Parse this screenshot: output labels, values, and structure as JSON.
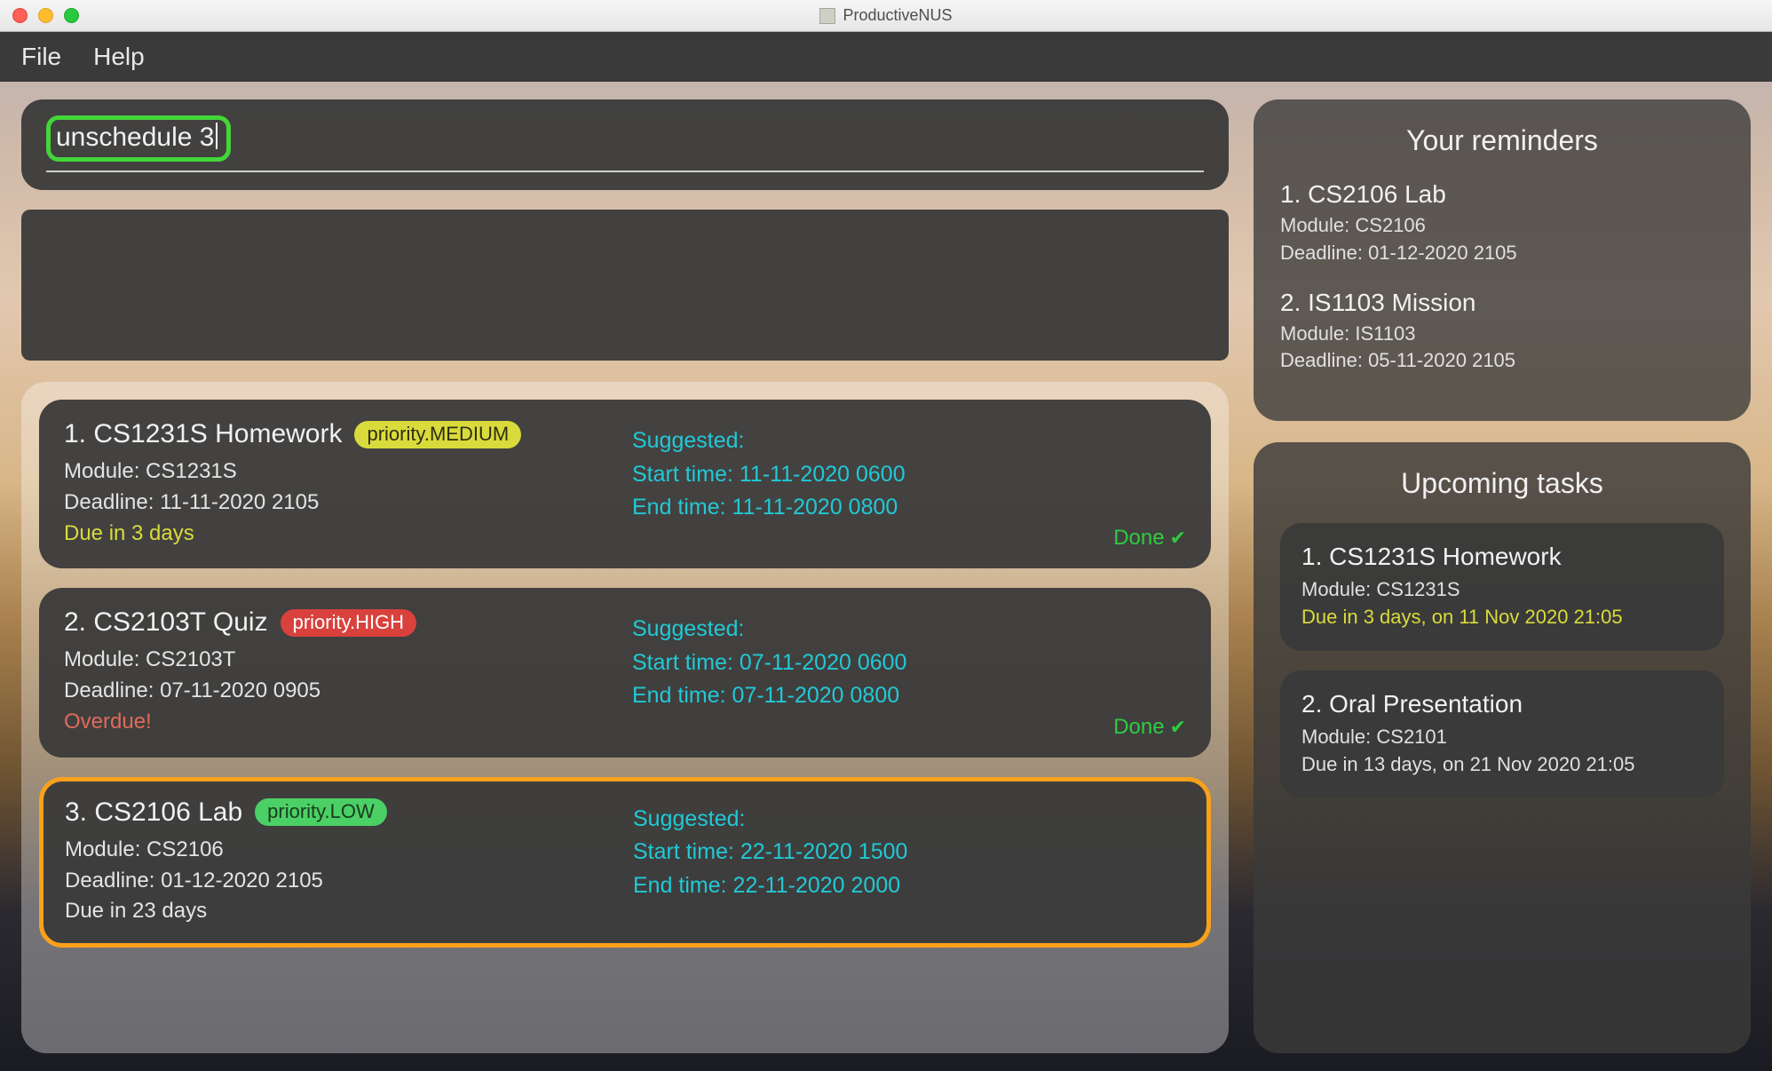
{
  "window": {
    "title": "ProductiveNUS"
  },
  "menu": {
    "file": "File",
    "help": "Help"
  },
  "command_input": {
    "value": "unschedule 3"
  },
  "tasks": [
    {
      "index": "1.",
      "title": "CS1231S Homework",
      "priority_label": "priority.MEDIUM",
      "priority_level": "medium",
      "module": "Module: CS1231S",
      "deadline": "Deadline: 11-11-2020 2105",
      "due_text": "Due in 3 days",
      "due_class": "due-soft",
      "suggested_header": "Suggested:",
      "suggested_start": "Start time: 11-11-2020 0600",
      "suggested_end": "End time: 11-11-2020 0800",
      "done": "Done",
      "selected": false
    },
    {
      "index": "2.",
      "title": "CS2103T Quiz",
      "priority_label": "priority.HIGH",
      "priority_level": "high",
      "module": "Module: CS2103T",
      "deadline": "Deadline: 07-11-2020 0905",
      "due_text": "Overdue!",
      "due_class": "overdue",
      "suggested_header": "Suggested:",
      "suggested_start": "Start time: 07-11-2020 0600",
      "suggested_end": "End time: 07-11-2020 0800",
      "done": "Done",
      "selected": false
    },
    {
      "index": "3.",
      "title": "CS2106 Lab",
      "priority_label": "priority.LOW",
      "priority_level": "low",
      "module": "Module: CS2106",
      "deadline": "Deadline: 01-12-2020 2105",
      "due_text": "Due in 23 days",
      "due_class": "",
      "suggested_header": "Suggested:",
      "suggested_start": "Start time: 22-11-2020 1500",
      "suggested_end": "End time: 22-11-2020 2000",
      "done": "",
      "selected": true
    }
  ],
  "reminders": {
    "title": "Your reminders",
    "items": [
      {
        "index": "1.",
        "title": "CS2106 Lab",
        "module": "Module: CS2106",
        "deadline": "Deadline: 01-12-2020 2105"
      },
      {
        "index": "2.",
        "title": "IS1103 Mission",
        "module": "Module: IS1103",
        "deadline": "Deadline: 05-11-2020 2105"
      }
    ]
  },
  "upcoming": {
    "title": "Upcoming tasks",
    "items": [
      {
        "index": "1.",
        "title": "CS1231S Homework",
        "module": "Module: CS1231S",
        "due": "Due in 3 days, on 11 Nov 2020 21:05",
        "due_highlight": true
      },
      {
        "index": "2.",
        "title": "Oral Presentation",
        "module": "Module: CS2101",
        "due": "Due in 13 days, on 21 Nov 2020 21:05",
        "due_highlight": false
      }
    ]
  }
}
